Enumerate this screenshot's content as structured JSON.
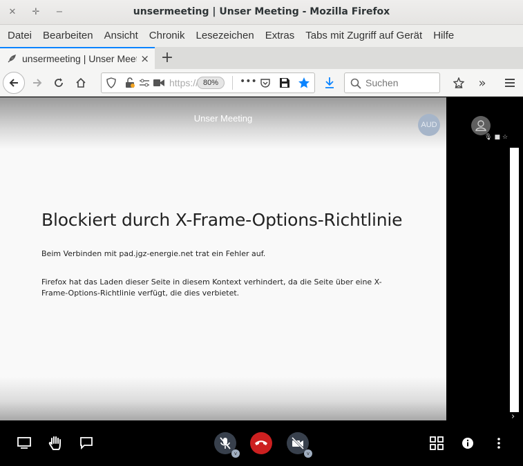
{
  "window": {
    "title": "unsermeeting | Unser Meeting - Mozilla Firefox",
    "buttons": [
      "close-icon",
      "restore-icon",
      "minimize-icon"
    ]
  },
  "menubar": {
    "items": [
      {
        "label": "Datei"
      },
      {
        "label": "Bearbeiten"
      },
      {
        "label": "Ansicht"
      },
      {
        "label": "Chronik"
      },
      {
        "label": "Lesezeichen"
      },
      {
        "label": "Extras"
      },
      {
        "label": "Tabs mit Zugriff auf Gerät"
      },
      {
        "label": "Hilfe"
      }
    ]
  },
  "tab": {
    "title": "unsermeeting | Unser Meeting",
    "close": "×",
    "new_tab": "+"
  },
  "navbar": {
    "url": "https://",
    "zoom": "80%",
    "search_placeholder": "Suchen",
    "accent_color": "#0a84ff"
  },
  "page": {
    "meeting_title": "Unser Meeting",
    "participant_badge": "AUD",
    "error_title": "Blockiert durch X-Frame-Options-Richtlinie",
    "error_line1": "Beim Verbinden mit pad.jgz-energie.net trat ein Fehler auf.",
    "error_line2": "Firefox hat das Laden dieser Seite in diesem Kontext verhindert, da die Seite über eine X-Frame-Options-Richtlinie verfügt, die dies verbietet."
  },
  "toolbar": {
    "left": [
      "screen-share-icon",
      "raise-hand-icon",
      "chat-icon"
    ],
    "center": [
      "microphone-muted-icon",
      "hangup-icon",
      "camera-muted-icon"
    ],
    "right": [
      "tile-view-icon",
      "info-icon",
      "more-options-icon"
    ],
    "hangup_color": "#cc2020"
  }
}
